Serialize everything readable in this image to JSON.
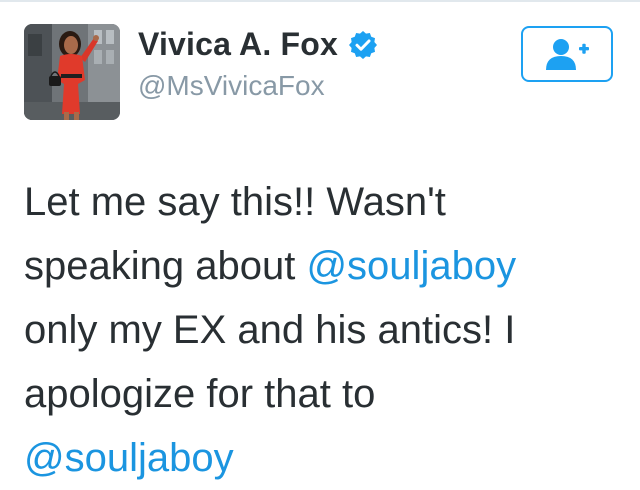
{
  "author": {
    "display_name": "Vivica A. Fox",
    "handle": "@MsVivicaFox",
    "verified": true
  },
  "icons": {
    "verified": "verified-badge-icon",
    "follow": "add-user-icon"
  },
  "tweet": {
    "line1": "Let me say this!! Wasn't",
    "line2_prefix": "speaking about ",
    "mention1": "@souljaboy",
    "line3": "only my EX and his antics! I",
    "line4": "apologize for that to",
    "mention2": "@souljaboy"
  },
  "colors": {
    "link": "#1b95e0",
    "accent": "#1da1f2",
    "text": "#292f33",
    "secondary": "#8899a6"
  }
}
